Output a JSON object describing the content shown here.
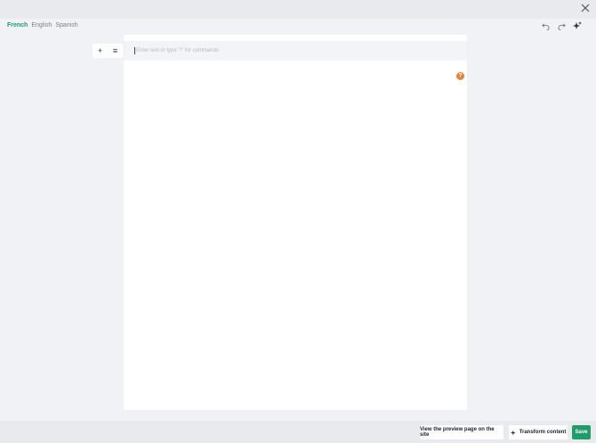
{
  "languages": {
    "items": [
      "French",
      "English",
      "Spanish"
    ],
    "active": "French"
  },
  "editor": {
    "placeholder": "Enter text or type \"/\" for commands",
    "badge_text": "?"
  },
  "toolbar": {
    "add_label": "+",
    "drag_label": "≡"
  },
  "footer": {
    "preview_label": "View the preview page on the site",
    "transform_label": "Transform content",
    "save_label": "Save"
  },
  "colors": {
    "accent": "#1f9b6c",
    "warning": "#e8803a"
  },
  "icons": {
    "close": "close-icon",
    "undo": "undo-icon",
    "redo": "redo-icon",
    "ai": "sparkle-icon"
  }
}
